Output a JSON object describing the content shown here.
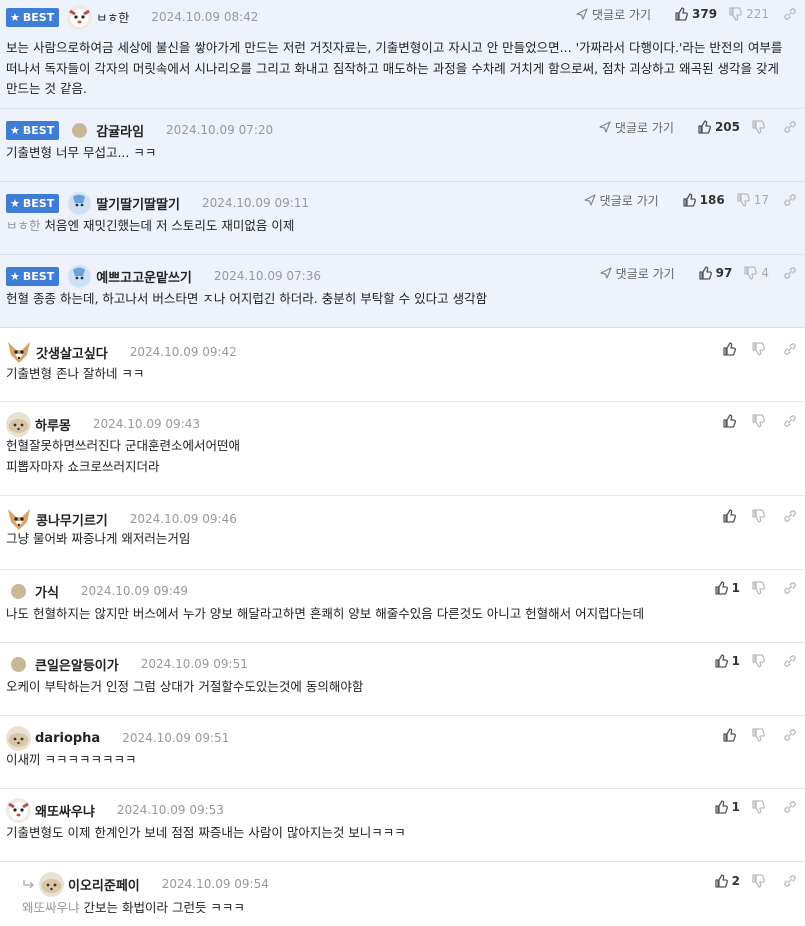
{
  "labels": {
    "best": "BEST",
    "reply": "댓글로 가기"
  },
  "colors": {
    "best_bg": "#eef2fb",
    "badge": "#3e7cd6",
    "mention": "#999999"
  },
  "comments": [
    {
      "best": true,
      "avatar": "dog-white",
      "nick": "ㅂㅎ한",
      "date": "2024.10.09 08:42",
      "text": "보는 사람으로하여금 세상에 불신을 쌓아가게 만드는 저런 거짓자료는, 기출변형이고 자시고 안 만들었으면... '가짜라서 다행이다.'라는 반전의 여부를 떠나서 독자들이 각자의 머릿속에서 시나리오를 그리고 화내고 짐작하고 매도하는 과정을 수차례 거치게 함으로써, 점차 괴상하고 왜곡된 생각을 갖게 만드는 것 같음.",
      "up": "379",
      "down": "221",
      "reply": true
    },
    {
      "best": true,
      "avatar": "dot",
      "nick": "감귤라임",
      "date": "2024.10.09 07:20",
      "text": "기출변형 너무 무섭고... ㅋㅋ",
      "up": "205",
      "down": "",
      "reply": true
    },
    {
      "best": true,
      "avatar": "pony-blue",
      "nick": "딸기딸기딸딸기",
      "date": "2024.10.09 09:11",
      "mention": "ㅂㅎ한",
      "text": "처음엔 재밋긴했는데 저 스토리도 재미없음 이제",
      "up": "186",
      "down": "17",
      "reply": true
    },
    {
      "best": true,
      "avatar": "pony-blue",
      "nick": "예쁘고고운맡쓰기",
      "date": "2024.10.09 07:36",
      "text": "헌혈 종종 하는데, 하고나서 버스타면 ㅈ나 어지럽긴 하더라. 충분히 부탁할 수 있다고 생각함",
      "up": "97",
      "down": "4",
      "reply": true
    },
    {
      "best": false,
      "avatar": "fennec",
      "nick": "갓생살고싶다",
      "date": "2024.10.09 09:42",
      "text": "기출변형 존나 잘하네 ㅋㅋ",
      "up": "",
      "down": ""
    },
    {
      "best": false,
      "avatar": "pup",
      "nick": "하루몽",
      "date": "2024.10.09 09:43",
      "text": "헌혈잘못하면쓰러진다 군대훈련소에서어떤애\n피뽑자마자 쇼크로쓰러지더라",
      "up": "",
      "down": ""
    },
    {
      "best": false,
      "avatar": "fennec",
      "nick": "콩나무기르기",
      "date": "2024.10.09 09:46",
      "text": "그냥 물어봐 짜증나게 왜저러는거임",
      "up": "",
      "down": ""
    },
    {
      "best": false,
      "avatar": "dot",
      "nick": "가식",
      "date": "2024.10.09 09:49",
      "text": "나도 헌혈하지는 않지만 버스에서 누가 양보 해달라고하면 흔쾌히 양보 해줄수있음 다른것도 아니고 헌혈해서 어지럽다는데",
      "up": "1",
      "down": ""
    },
    {
      "best": false,
      "avatar": "dot",
      "nick": "큰일은알등이가",
      "date": "2024.10.09 09:51",
      "text": "오케이 부탁하는거 인정 그럼 상대가 거절할수도있는것에 동의해야함",
      "up": "1",
      "down": ""
    },
    {
      "best": false,
      "avatar": "pup",
      "nick": "dariopha",
      "date": "2024.10.09 09:51",
      "text": "이새끼 ㅋㅋㅋㅋㅋㅋㅋㅋ",
      "up": "",
      "down": ""
    },
    {
      "best": false,
      "avatar": "dog-white",
      "nick": "왜또싸우냐",
      "date": "2024.10.09 09:53",
      "text": "기출변형도 이제 한계인가 보네 점점 짜증내는 사람이 많아지는것 보니ㅋㅋㅋ",
      "up": "1",
      "down": ""
    },
    {
      "best": false,
      "avatar": "pup",
      "nick": "이오리준페이",
      "date": "2024.10.09 09:54",
      "mention": "왜또싸우냐",
      "text": "간보는 화법이라 그런듯 ㅋㅋㅋ",
      "up": "2",
      "down": "",
      "is_reply": true
    }
  ]
}
